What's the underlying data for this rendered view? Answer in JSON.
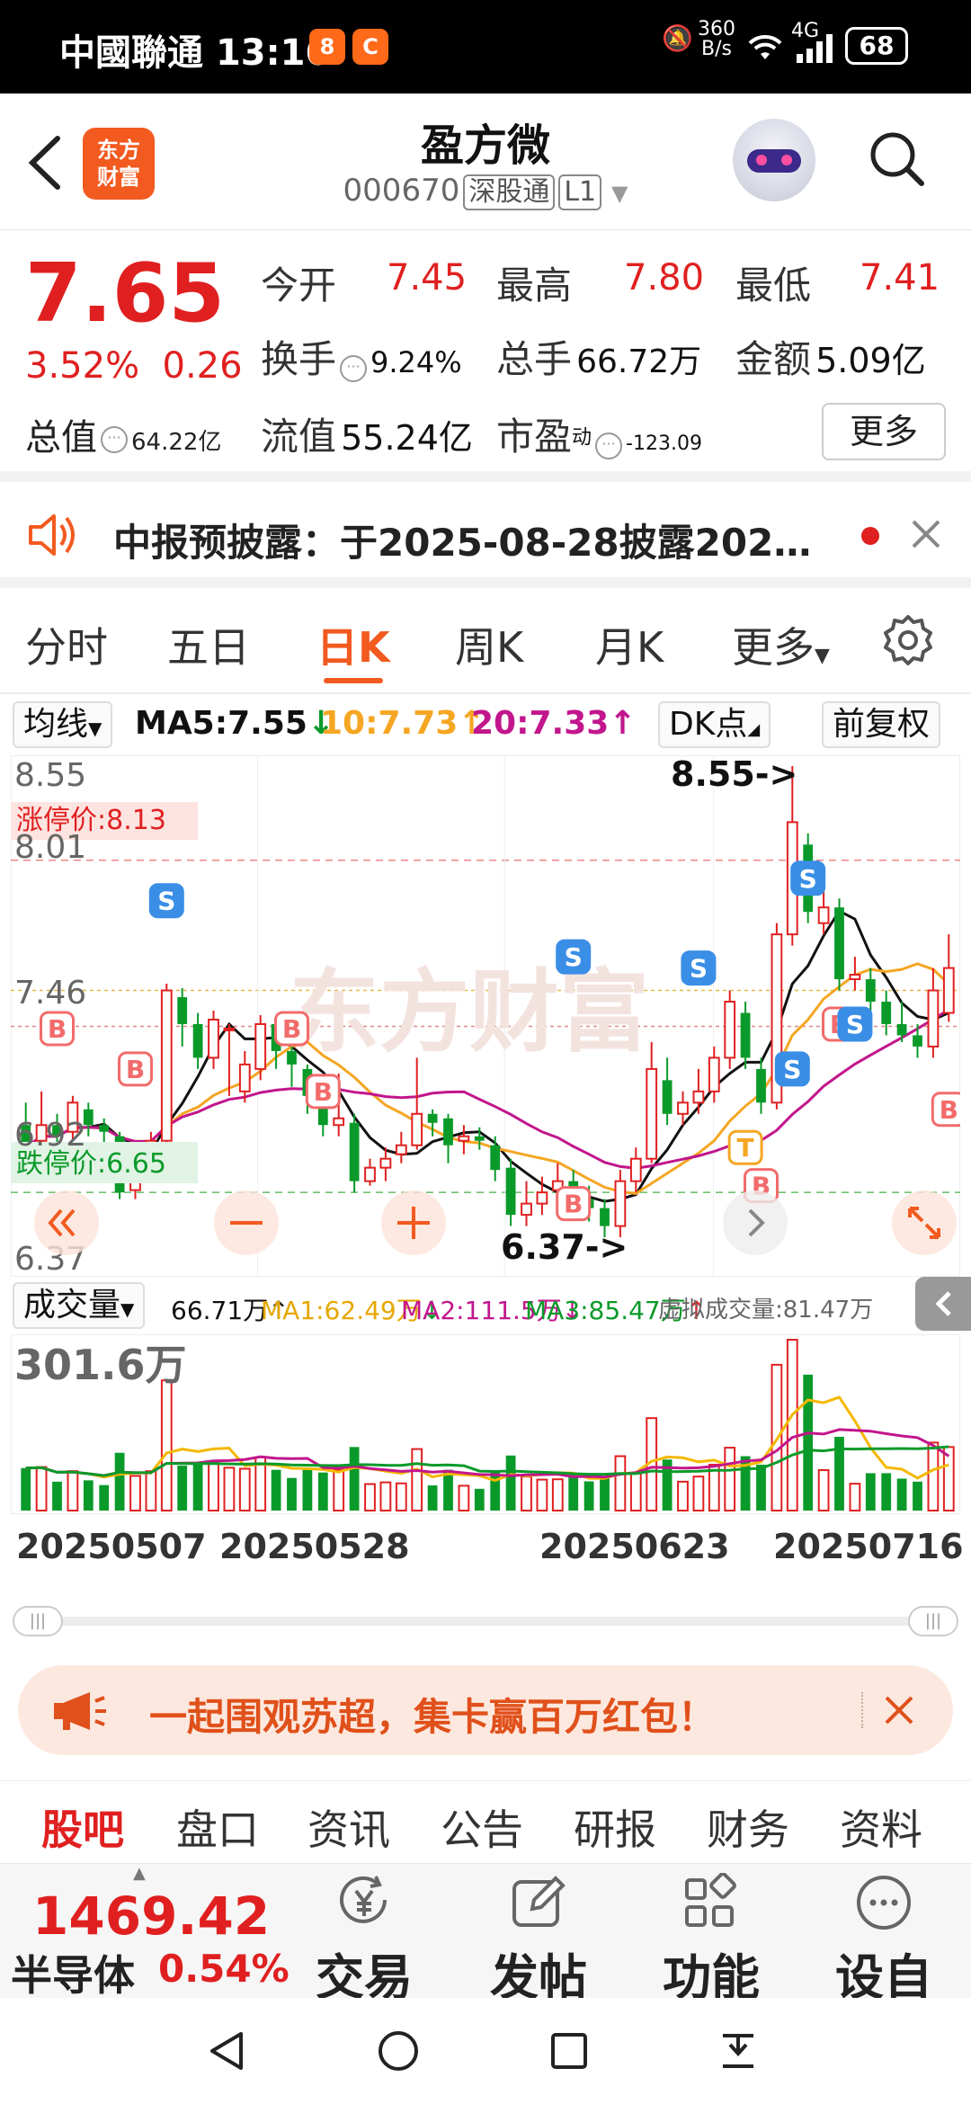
{
  "status_bar": {
    "carrier": "中國聯通",
    "time": "13:16",
    "net_speed_value": "360",
    "net_speed_unit": "B/s",
    "signal_type": "4G",
    "battery": "68"
  },
  "header": {
    "title": "盈方微",
    "code": "000670",
    "tag_connect": "深股通",
    "tag_level": "L1",
    "logo_line1": "东方",
    "logo_line2": "财富"
  },
  "quote": {
    "price": "7.65",
    "change_pct": "3.52%",
    "change_amt": "0.26",
    "open_label": "今开",
    "open": "7.45",
    "high_label": "最高",
    "high": "7.80",
    "low_label": "最低",
    "low": "7.41",
    "turnover_label": "换手",
    "turnover": "9.24%",
    "volume_label": "总手",
    "volume": "66.72万",
    "amount_label": "金额",
    "amount": "5.09亿",
    "mcap_label": "总值",
    "mcap": "64.22亿",
    "float_label": "流值",
    "float": "55.24亿",
    "pe_label": "市盈",
    "pe_sup": "动",
    "pe": "-123.09",
    "more": "更多"
  },
  "notice": {
    "text": "中报预披露：于2025-08-28披露2025..."
  },
  "chart_tabs": [
    "分时",
    "五日",
    "日K",
    "周K",
    "月K",
    "更多"
  ],
  "active_tab": 2,
  "ma_bar": {
    "selector": "均线",
    "ma5": "MA5:7.55",
    "ma10": "10:7.73",
    "ma20": "20:7.33",
    "dk": "DK点",
    "adjust": "前复权"
  },
  "kline": {
    "top_price": "8.55",
    "bottom_price": "6.37",
    "limit_up": "涨停价:8.13",
    "limit_down": "跌停价:6.65",
    "gridlabel_1": "8.01",
    "gridlabel_2": "7.46",
    "gridlabel_3": "6.92",
    "high_marker": "8.55->",
    "low_marker": "6.37->",
    "watermark": "东方财富"
  },
  "volume_bar": {
    "selector": "成交量",
    "vol": "66.71万",
    "ma1": "MA1:62.49万",
    "ma2": "MA2:111.5万",
    "ma3": "MA3:85.47万",
    "virtual": "虚拟成交量:81.47万",
    "max": "301.6万"
  },
  "dates": [
    "20250507",
    "20250528",
    "20250623",
    "20250716"
  ],
  "banner": {
    "text": "一起围观苏超，集卡赢百万红包！"
  },
  "sub_tabs": [
    "股吧",
    "盘口",
    "资讯",
    "公告",
    "研报",
    "财务",
    "资料"
  ],
  "toolbar": {
    "index_value": "1469.42",
    "index_name": "半导体",
    "index_pct": "0.54%",
    "trade": "交易",
    "post": "发帖",
    "function": "功能",
    "watchlist": "设自选"
  },
  "colors": {
    "up": "#e02020",
    "down": "#0a9a2a",
    "accent": "#f25a1f",
    "ma5": "#111111",
    "ma10": "#f5a623",
    "ma20": "#c2168c"
  },
  "chart_data": {
    "type": "candlestick",
    "x_labels": [
      "20250507",
      "20250528",
      "20250623",
      "20250716"
    ],
    "ylim": [
      6.37,
      8.55
    ],
    "y_ticks": [
      8.55,
      8.01,
      7.46,
      6.92,
      6.37
    ],
    "limit_up": 8.13,
    "limit_down": 6.65,
    "candles": [
      [
        6.95,
        6.85,
        7.05,
        6.8
      ],
      [
        6.88,
        6.95,
        7.1,
        6.82
      ],
      [
        6.95,
        6.9,
        7.0,
        6.85
      ],
      [
        6.92,
        7.05,
        7.08,
        6.88
      ],
      [
        7.02,
        6.95,
        7.05,
        6.9
      ],
      [
        6.95,
        6.92,
        6.98,
        6.85
      ],
      [
        6.9,
        6.65,
        6.92,
        6.62
      ],
      [
        6.66,
        6.75,
        6.8,
        6.62
      ],
      [
        6.75,
        6.88,
        6.92,
        6.72
      ],
      [
        6.88,
        7.55,
        7.58,
        6.85
      ],
      [
        7.52,
        7.4,
        7.56,
        7.3
      ],
      [
        7.4,
        7.25,
        7.45,
        7.2
      ],
      [
        7.25,
        7.42,
        7.46,
        7.2
      ],
      [
        7.38,
        7.38,
        7.4,
        7.08
      ],
      [
        7.1,
        7.22,
        7.28,
        7.05
      ],
      [
        7.2,
        7.4,
        7.44,
        7.15
      ],
      [
        7.4,
        7.28,
        7.42,
        7.2
      ],
      [
        7.28,
        7.22,
        7.3,
        7.12
      ],
      [
        7.2,
        7.08,
        7.22,
        7.0
      ],
      [
        7.06,
        6.95,
        7.1,
        6.9
      ],
      [
        6.95,
        6.98,
        7.18,
        6.9
      ],
      [
        6.96,
        6.7,
        7.0,
        6.65
      ],
      [
        6.7,
        6.76,
        6.8,
        6.68
      ],
      [
        6.76,
        6.8,
        6.85,
        6.7
      ],
      [
        6.82,
        6.86,
        6.92,
        6.78
      ],
      [
        6.86,
        7.0,
        7.25,
        6.84
      ],
      [
        7.0,
        6.96,
        7.02,
        6.9
      ],
      [
        6.98,
        6.86,
        7.0,
        6.78
      ],
      [
        6.88,
        6.9,
        6.95,
        6.82
      ],
      [
        6.9,
        6.88,
        6.94,
        6.84
      ],
      [
        6.86,
        6.75,
        6.9,
        6.7
      ],
      [
        6.76,
        6.55,
        6.8,
        6.5
      ],
      [
        6.55,
        6.6,
        6.7,
        6.5
      ],
      [
        6.6,
        6.65,
        6.72,
        6.55
      ],
      [
        6.66,
        6.7,
        6.78,
        6.6
      ],
      [
        6.7,
        6.62,
        6.75,
        6.55
      ],
      [
        6.62,
        6.58,
        6.68,
        6.52
      ],
      [
        6.58,
        6.5,
        6.62,
        6.45
      ],
      [
        6.5,
        6.7,
        6.75,
        6.45
      ],
      [
        6.7,
        6.8,
        6.85,
        6.65
      ],
      [
        6.8,
        7.2,
        7.32,
        6.78
      ],
      [
        7.15,
        7.0,
        7.25,
        6.95
      ],
      [
        7.0,
        7.05,
        7.1,
        6.95
      ],
      [
        7.05,
        7.1,
        7.2,
        7.0
      ],
      [
        7.1,
        7.25,
        7.3,
        7.05
      ],
      [
        7.25,
        7.5,
        7.55,
        7.2
      ],
      [
        7.45,
        7.25,
        7.5,
        7.2
      ],
      [
        7.2,
        7.05,
        7.25,
        7.0
      ],
      [
        7.05,
        7.8,
        7.85,
        7.02
      ],
      [
        7.8,
        8.3,
        8.55,
        7.75
      ],
      [
        8.2,
        7.9,
        8.25,
        7.85
      ],
      [
        7.85,
        7.92,
        8.05,
        7.8
      ],
      [
        7.92,
        7.6,
        7.96,
        7.55
      ],
      [
        7.6,
        7.62,
        7.7,
        7.55
      ],
      [
        7.6,
        7.5,
        7.65,
        7.45
      ],
      [
        7.5,
        7.4,
        7.55,
        7.35
      ],
      [
        7.4,
        7.35,
        7.5,
        7.32
      ],
      [
        7.35,
        7.3,
        7.4,
        7.25
      ],
      [
        7.3,
        7.55,
        7.65,
        7.25
      ],
      [
        7.45,
        7.65,
        7.8,
        7.41
      ]
    ],
    "ma_series": [
      {
        "name": "MA5",
        "value": 7.55
      },
      {
        "name": "MA10",
        "value": 7.73
      },
      {
        "name": "MA20",
        "value": 7.33
      }
    ],
    "volume_max": "301.6万"
  }
}
